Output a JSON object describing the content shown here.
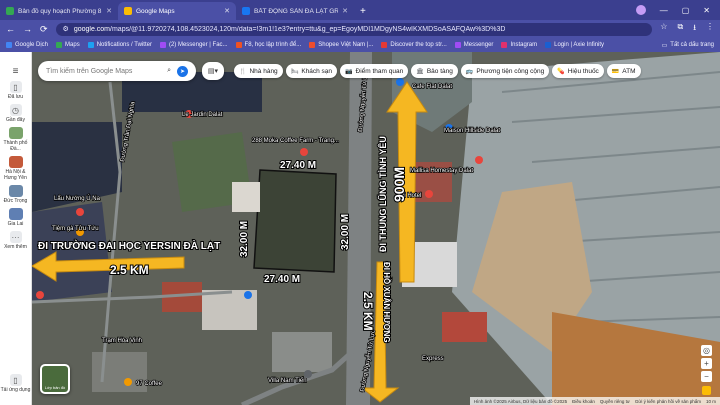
{
  "tabs": [
    {
      "title": "Bản đồ quy hoạch Phường 8, Th",
      "active": false,
      "color": "#34a853"
    },
    {
      "title": "Google Maps",
      "active": true,
      "color": "#fbbc04"
    },
    {
      "title": "BẤT ĐỘNG SẢN ĐÀ LẠT GROUP",
      "active": false,
      "color": "#1877f2"
    }
  ],
  "url": {
    "domain": "google.com",
    "path": "/maps/@11.9720274,108.4523024,120m/data=!3m1!1e3?entry=ttu&g_ep=EgoyMDI1MDgyNS4wIKXMDSoASAFQAw%3D%3D"
  },
  "bookmarks": [
    {
      "label": "Google Dịch",
      "color": "#4285f4"
    },
    {
      "label": "Maps",
      "color": "#34a853"
    },
    {
      "label": "Notifications / Twitter",
      "color": "#1da1f2"
    },
    {
      "label": "(2) Messenger | Fac...",
      "color": "#a04cf5"
    },
    {
      "label": "F8, học lập trình để...",
      "color": "#f05123"
    },
    {
      "label": "Shopee Việt Nam |...",
      "color": "#ee4d2d"
    },
    {
      "label": "Discover the top str...",
      "color": "#e53935"
    },
    {
      "label": "Messenger",
      "color": "#a04cf5"
    },
    {
      "label": "Instagram",
      "color": "#e1306c"
    },
    {
      "label": "Login | Axie Infinity",
      "color": "#1b5fd1"
    }
  ],
  "bookmarks_all": "Tất cả dấu trang",
  "rail": {
    "menu": "≡",
    "saved": "Đã lưu",
    "recent": "Gần đây",
    "places": [
      {
        "label": "Thành phố Đà...",
        "color": "#7aa36b"
      },
      {
        "label": "Hà Nội & Hưng Yên",
        "color": "#c45a3a"
      },
      {
        "label": "Đức Trọng",
        "color": "#6b88a8"
      },
      {
        "label": "Gia Lai",
        "color": "#5f7fb3"
      }
    ],
    "more": "Xem thêm",
    "download": "Tải ứng dụng"
  },
  "search": {
    "placeholder": "Tìm kiếm trên Google Maps"
  },
  "chips": [
    {
      "label": "Nhà hàng",
      "icon": "🍴"
    },
    {
      "label": "Khách sạn",
      "icon": "🛏"
    },
    {
      "label": "Điểm tham quan",
      "icon": "📷"
    },
    {
      "label": "Bảo tàng",
      "icon": "🏛"
    },
    {
      "label": "Phương tiện công cộng",
      "icon": "🚌"
    },
    {
      "label": "Hiệu thuốc",
      "icon": "💊"
    },
    {
      "label": "ATM",
      "icon": "💳"
    }
  ],
  "map_labels": {
    "le_jardin": "Le Jardin Dalat",
    "moka": "288 Moka Coffee Farm - Trang...",
    "cafe": "Cafe Flat Dalat",
    "maison": "Maison Hillside Dalat",
    "mallisa": "Mallisa Homestay Dalat",
    "fuji": "Fuji Hotel",
    "tiem_ga": "Tiệm gà Tửu Tứu",
    "nuong": "Lẩu Nướng Ú Na",
    "duong_tran": "Đường Trần Đại Nghĩa",
    "duong_nguyen": "Đường Nguyễn Tử Lực",
    "duong_nguyen2": "Đường Nguyễn Tử Lực",
    "villa": "Villa Nam Tiến",
    "coffee": "97 Coffee",
    "hoa": "Trạm Hòa Vinh",
    "layer": "Lớp bản đồ",
    "express": "Express"
  },
  "annotations": {
    "top": "27.40 M",
    "bottom": "27.40 M",
    "left": "32.00 M",
    "right": "32.00 M",
    "versin": "ĐI TRƯỜNG ĐẠI HỌC YERSIN ĐÀ LẠT",
    "versin_dist": "2.5 KM",
    "vien": "ĐI THUNG LŨNG TÌNH YÊU",
    "vien_dist": "900M",
    "xuan": "ĐI HỒ XUÂN HƯƠNG",
    "xuan_dist": "2.5 KM"
  },
  "attribution": {
    "text": "Hình ảnh ©2025 Airbus, Dữ liệu bản đồ ©2025",
    "terms": "Điều khoản",
    "privacy": "Quyền riêng tư",
    "feedback": "Gửi ý kiến phản hồi về sản phẩm",
    "scale": "10 m"
  }
}
